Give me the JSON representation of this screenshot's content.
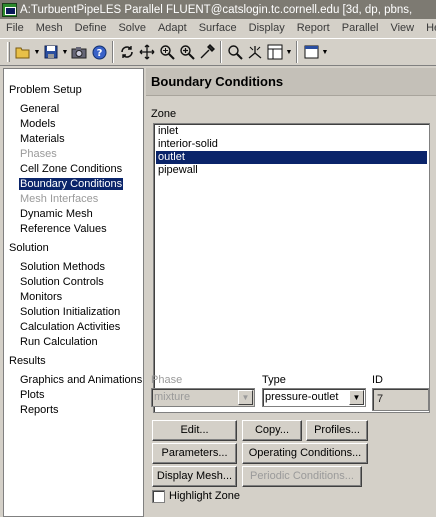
{
  "window": {
    "title": "A:TurbuentPipeLES Parallel FLUENT@catslogin.tc.cornell.edu  [3d, dp, pbns,"
  },
  "menu": [
    "File",
    "Mesh",
    "Define",
    "Solve",
    "Adapt",
    "Surface",
    "Display",
    "Report",
    "Parallel",
    "View",
    "Help"
  ],
  "toolbar": {
    "icons": [
      "open-folder-icon",
      "save-icon",
      "camera-icon",
      "help-icon",
      "rotate-icon",
      "pan-icon",
      "zoom-icon",
      "zoom-in-icon",
      "probe-icon",
      "zoom-to-fit-icon",
      "axes-icon",
      "layout-icon",
      "window-icon"
    ]
  },
  "tree": {
    "sections": [
      {
        "label": "Problem Setup",
        "items": [
          {
            "label": "General",
            "state": "normal"
          },
          {
            "label": "Models",
            "state": "normal"
          },
          {
            "label": "Materials",
            "state": "normal"
          },
          {
            "label": "Phases",
            "state": "disabled"
          },
          {
            "label": "Cell Zone Conditions",
            "state": "normal"
          },
          {
            "label": "Boundary Conditions",
            "state": "selected"
          },
          {
            "label": "Mesh Interfaces",
            "state": "disabled"
          },
          {
            "label": "Dynamic Mesh",
            "state": "normal"
          },
          {
            "label": "Reference Values",
            "state": "normal"
          }
        ]
      },
      {
        "label": "Solution",
        "items": [
          {
            "label": "Solution Methods",
            "state": "normal"
          },
          {
            "label": "Solution Controls",
            "state": "normal"
          },
          {
            "label": "Monitors",
            "state": "normal"
          },
          {
            "label": "Solution Initialization",
            "state": "normal"
          },
          {
            "label": "Calculation Activities",
            "state": "normal"
          },
          {
            "label": "Run Calculation",
            "state": "normal"
          }
        ]
      },
      {
        "label": "Results",
        "items": [
          {
            "label": "Graphics and Animations",
            "state": "normal"
          },
          {
            "label": "Plots",
            "state": "normal"
          },
          {
            "label": "Reports",
            "state": "normal"
          }
        ]
      }
    ]
  },
  "panel": {
    "title": "Boundary Conditions",
    "zone_label": "Zone",
    "zones": [
      {
        "label": "inlet",
        "selected": false
      },
      {
        "label": "interior-solid",
        "selected": false
      },
      {
        "label": "outlet",
        "selected": true
      },
      {
        "label": "pipewall",
        "selected": false
      }
    ],
    "phase_label": "Phase",
    "phase_value": "mixture",
    "type_label": "Type",
    "type_value": "pressure-outlet",
    "id_label": "ID",
    "id_value": "7",
    "buttons": {
      "edit": "Edit...",
      "copy": "Copy...",
      "profiles": "Profiles...",
      "parameters": "Parameters...",
      "operating_conditions": "Operating Conditions...",
      "display_mesh": "Display Mesh...",
      "periodic_conditions": "Periodic Conditions..."
    },
    "highlight_zone_label": "Highlight Zone",
    "highlight_zone_checked": false
  }
}
